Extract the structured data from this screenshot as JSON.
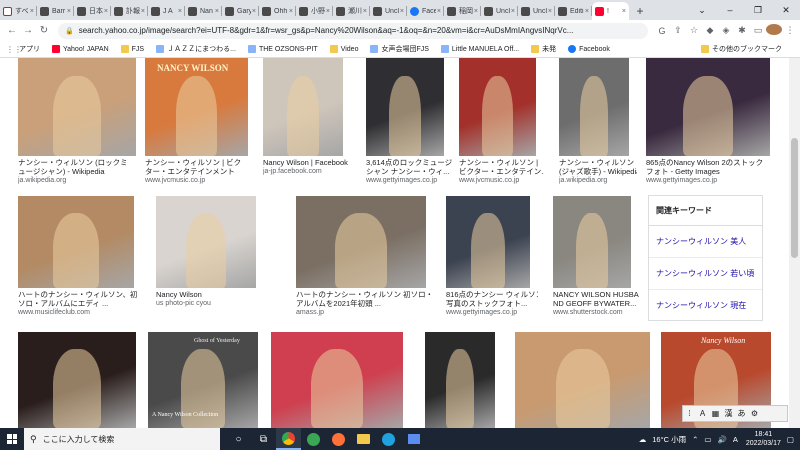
{
  "tabs": [
    {
      "label": "すべ",
      "icon": "gmail-icon"
    },
    {
      "label": "Barr",
      "icon": "page-icon"
    },
    {
      "label": "日本",
      "icon": "page-icon"
    },
    {
      "label": "訃報",
      "icon": "page-icon"
    },
    {
      "label": "J A",
      "icon": "page-icon"
    },
    {
      "label": "Nan",
      "icon": "page-icon"
    },
    {
      "label": "Gary",
      "icon": "page-icon"
    },
    {
      "label": "Ohh",
      "icon": "page-icon"
    },
    {
      "label": "小野",
      "icon": "page-icon"
    },
    {
      "label": "瀬川",
      "icon": "page-icon"
    },
    {
      "label": "Uncl",
      "icon": "page-icon"
    },
    {
      "label": "Face",
      "icon": "facebook-icon"
    },
    {
      "label": "稲岡",
      "icon": "page-icon"
    },
    {
      "label": "Uncl",
      "icon": "page-icon"
    },
    {
      "label": "Uncl",
      "icon": "page-icon"
    },
    {
      "label": "Editi",
      "icon": "page-icon"
    },
    {
      "label": "!",
      "icon": "yahoo-icon"
    }
  ],
  "active_tab_index": 16,
  "toolbar": {
    "url": "search.yahoo.co.jp/image/search?ei=UTF-8&gdr=1&fr=wsr_gs&p=Nancy%20Wilson&aq=-1&oq=&n=20&vm=i&cr=AuDsMmIAngvsINqrVc..."
  },
  "bookmarks": [
    {
      "label": "アプリ",
      "icon": "apps-grid-icon"
    },
    {
      "label": "Yahoo! JAPAN",
      "icon": "yahoo-japan-icon"
    },
    {
      "label": "FJS",
      "icon": "folder-icon"
    },
    {
      "label": "ＪＡＺＺにまつわる...",
      "icon": "page-icon"
    },
    {
      "label": "THE OZSONS-PIT",
      "icon": "page-icon"
    },
    {
      "label": "Video",
      "icon": "folder-icon"
    },
    {
      "label": "女声会場団FJS",
      "icon": "page-icon"
    },
    {
      "label": "Little MANUELA Off...",
      "icon": "page-icon"
    },
    {
      "label": "未発",
      "icon": "folder-icon"
    },
    {
      "label": "Facebook",
      "icon": "facebook-icon"
    }
  ],
  "bookmarks_other": "その他のブックマーク",
  "results": [
    {
      "caption1": "ナンシー・ウィルソン (ロックミ",
      "caption2": "ュージシャン) - Wikipedia",
      "source": "ja.wikipedia.org",
      "color": "#c9a07a"
    },
    {
      "caption1": "ナンシー・ウィルソン | ビク",
      "caption2": "ター・エンタテインメント",
      "source": "www.jvcmusic.co.jp",
      "color": "#d87a3e"
    },
    {
      "caption1": "Nancy Wilson | Facebook",
      "caption2": "",
      "source": "ja-jp.facebook.com",
      "color": "#cfc6bb"
    },
    {
      "caption1": "3,614点のロックミュージ",
      "caption2": "シャン ナンシー・ウィ...",
      "source": "www.gettyimages.co.jp",
      "color": "#2f2f33"
    },
    {
      "caption1": "ナンシー・ウィルソン |",
      "caption2": "ビクター・エンタテイン...",
      "source": "www.jvcmusic.co.jp",
      "color": "#a3302a"
    },
    {
      "caption1": "ナンシー・ウィルソン",
      "caption2": "(ジャズ歌手) - Wikipedia",
      "source": "ja.wikipedia.org",
      "color": "#6d6d6d"
    },
    {
      "caption1": "865点のNancy Wilson 2のストック",
      "caption2": "フォト - Getty Images",
      "source": "www.gettyimages.co.jp",
      "color": "#3a2a3f"
    },
    {
      "caption1": "ハートのナンシー・ウィルソン、初",
      "caption2": "ソロ・アルバムにエディ ...",
      "source": "www.musiclifeclub.com",
      "color": "#b38a63"
    },
    {
      "caption1": "Nancy Wilson",
      "caption2": "",
      "source": "us photo-pic cyou",
      "color": "#d9d4cf"
    },
    {
      "caption1": "ハートのナンシー・ウィルソン 初ソロ・",
      "caption2": "アルバムを2021年初頭 ...",
      "source": "amass.jp",
      "color": "#7b6f63"
    },
    {
      "caption1": "816点のナンシー ウィルソン",
      "caption2": "写真のストックフォト...",
      "source": "www.gettyimages.co.jp",
      "color": "#3b4250"
    },
    {
      "caption1": "NANCY WILSON HUSBA",
      "caption2": "ND GEOFF BYWATER...",
      "source": "www.shutterstock.com",
      "color": "#8a8780"
    },
    {
      "caption1": "",
      "caption2": "",
      "source": "",
      "color": "#2a1e1c"
    },
    {
      "caption1": "",
      "caption2": "",
      "source": "",
      "color": "#4a4a4a"
    },
    {
      "caption1": "",
      "caption2": "",
      "source": "",
      "color": "#cf3f4f"
    },
    {
      "caption1": "",
      "caption2": "",
      "source": "",
      "color": "#2b2a2a"
    },
    {
      "caption1": "",
      "caption2": "",
      "source": "",
      "color": "#c99a6f"
    },
    {
      "caption1": "",
      "caption2": "",
      "source": "",
      "color": "#b9492d"
    }
  ],
  "album_text": {
    "r2_title": "NANCY WILSON",
    "r3_a": "Ghost of Yesterday",
    "r3_b": "A Nancy Wilson Collection",
    "r3_c": "Nancy Wilson"
  },
  "keyword_panel": {
    "title": "関連キーワード",
    "items": [
      "ナンシーウィルソン 美人",
      "ナンシーウィルソン 若い頃",
      "ナンシーウィルソン 現在"
    ]
  },
  "ime_bar": [
    "あ",
    "A",
    "漢",
    "⚙"
  ],
  "taskbar": {
    "search_placeholder": "ここに入力して検索",
    "weather": "16°C 小雨",
    "time": "18:41",
    "date": "2022/03/17",
    "ime": "A"
  }
}
